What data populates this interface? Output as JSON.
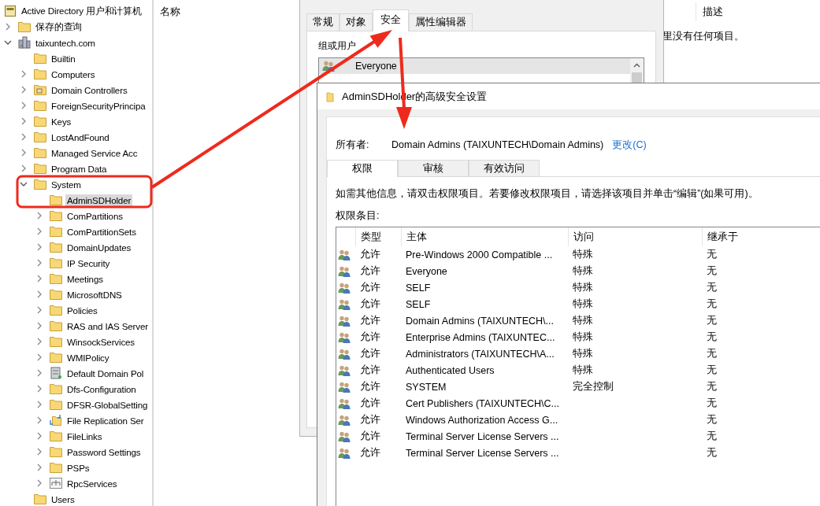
{
  "tree": {
    "title": {
      "label": "Active Directory 用户和计算机",
      "kind": "console"
    },
    "items": [
      {
        "label": "保存的查询",
        "kind": "folder",
        "expanded": false,
        "selected": false
      },
      {
        "label": "taixuntech.com",
        "kind": "domain",
        "expanded": true,
        "selected": false,
        "children": [
          {
            "label": "Builtin",
            "kind": "folder",
            "selected": false
          },
          {
            "label": "Computers",
            "kind": "folder",
            "expanded": false,
            "selected": false
          },
          {
            "label": "Domain Controllers",
            "kind": "ou",
            "expanded": false,
            "selected": false
          },
          {
            "label": "ForeignSecurityPrincipa",
            "kind": "folder",
            "expanded": false,
            "selected": false
          },
          {
            "label": "Keys",
            "kind": "folder",
            "expanded": false,
            "selected": false
          },
          {
            "label": "LostAndFound",
            "kind": "folder",
            "expanded": false,
            "selected": false
          },
          {
            "label": "Managed Service Acc",
            "kind": "folder",
            "expanded": false,
            "selected": false
          },
          {
            "label": "Program Data",
            "kind": "folder",
            "expanded": false,
            "selected": false
          },
          {
            "label": "System",
            "kind": "folder",
            "expanded": true,
            "selected": false,
            "children": [
              {
                "label": "AdminSDHolder",
                "kind": "folder",
                "selected": true
              },
              {
                "label": "ComPartitions",
                "kind": "folder",
                "expanded": false,
                "selected": false
              },
              {
                "label": "ComPartitionSets",
                "kind": "folder",
                "expanded": false,
                "selected": false
              },
              {
                "label": "DomainUpdates",
                "kind": "folder",
                "expanded": false,
                "selected": false
              },
              {
                "label": "IP Security",
                "kind": "folder",
                "expanded": false,
                "selected": false
              },
              {
                "label": "Meetings",
                "kind": "folder",
                "expanded": false,
                "selected": false
              },
              {
                "label": "MicrosoftDNS",
                "kind": "folder",
                "expanded": false,
                "selected": false
              },
              {
                "label": "Policies",
                "kind": "folder",
                "expanded": false,
                "selected": false
              },
              {
                "label": "RAS and IAS Server",
                "kind": "folder",
                "expanded": false,
                "selected": false
              },
              {
                "label": "WinsockServices",
                "kind": "folder",
                "expanded": false,
                "selected": false
              },
              {
                "label": "WMIPolicy",
                "kind": "folder",
                "expanded": false,
                "selected": false
              },
              {
                "label": "Default Domain Pol",
                "kind": "policy",
                "expanded": false,
                "selected": false
              },
              {
                "label": "Dfs-Configuration",
                "kind": "folder",
                "expanded": false,
                "selected": false
              },
              {
                "label": "DFSR-GlobalSetting",
                "kind": "folder",
                "expanded": false,
                "selected": false
              },
              {
                "label": "File Replication Ser",
                "kind": "sync",
                "expanded": false,
                "selected": false
              },
              {
                "label": "FileLinks",
                "kind": "folder",
                "expanded": false,
                "selected": false
              },
              {
                "label": "Password Settings",
                "kind": "folder",
                "expanded": false,
                "selected": false
              },
              {
                "label": "PSPs",
                "kind": "folder",
                "expanded": false,
                "selected": false
              },
              {
                "label": "RpcServices",
                "kind": "network",
                "expanded": false,
                "selected": false
              }
            ]
          },
          {
            "label": "Users",
            "kind": "folder",
            "selected": false
          }
        ]
      }
    ]
  },
  "list": {
    "columns": [
      "名称",
      "描述"
    ],
    "empty_text": "里没有任何项目。"
  },
  "properties_dialog": {
    "tabs": [
      {
        "label": "常规",
        "selected": false
      },
      {
        "label": "对象",
        "selected": false
      },
      {
        "label": "安全",
        "selected": true
      },
      {
        "label": "属性编辑器",
        "selected": false
      }
    ],
    "group_label": "组或用户",
    "groups": [
      {
        "name": "Everyone",
        "selected": true
      }
    ]
  },
  "advanced_dialog": {
    "title": "AdminSDHolder的高级安全设置",
    "owner_label": "所有者:",
    "owner": "Domain Admins (TAIXUNTECH\\Domain Admins)",
    "change_link": "更改(C)",
    "tabs": [
      {
        "label": "权限",
        "selected": true
      },
      {
        "label": "审核",
        "selected": false
      },
      {
        "label": "有效访问",
        "selected": false
      }
    ],
    "info": "如需其他信息，请双击权限项目。若要修改权限项目，请选择该项目并单击“编辑”(如果可用)。",
    "entries_label": "权限条目:",
    "columns": [
      "类型",
      "主体",
      "访问",
      "继承于"
    ],
    "rows": [
      {
        "type": "允许",
        "principal": "Pre-Windows 2000 Compatible ...",
        "access": "特殊",
        "inherited_from": "无"
      },
      {
        "type": "允许",
        "principal": "Everyone",
        "access": "特殊",
        "inherited_from": "无"
      },
      {
        "type": "允许",
        "principal": "SELF",
        "access": "特殊",
        "inherited_from": "无"
      },
      {
        "type": "允许",
        "principal": "SELF",
        "access": "特殊",
        "inherited_from": "无"
      },
      {
        "type": "允许",
        "principal": "Domain Admins (TAIXUNTECH\\...",
        "access": "特殊",
        "inherited_from": "无"
      },
      {
        "type": "允许",
        "principal": "Enterprise Admins (TAIXUNTEC...",
        "access": "特殊",
        "inherited_from": "无"
      },
      {
        "type": "允许",
        "principal": "Administrators (TAIXUNTECH\\A...",
        "access": "特殊",
        "inherited_from": "无"
      },
      {
        "type": "允许",
        "principal": "Authenticated Users",
        "access": "特殊",
        "inherited_from": "无"
      },
      {
        "type": "允许",
        "principal": "SYSTEM",
        "access": "完全控制",
        "inherited_from": "无"
      },
      {
        "type": "允许",
        "principal": "Cert Publishers (TAIXUNTECH\\C...",
        "inherited_from": "无"
      },
      {
        "type": "允许",
        "principal": "Windows Authorization Access G...",
        "inherited_from": "无"
      },
      {
        "type": "允许",
        "principal": "Terminal Server License Servers ...",
        "inherited_from": "无"
      },
      {
        "type": "允许",
        "principal": "Terminal Server License Servers ...",
        "inherited_from": "无"
      }
    ]
  }
}
